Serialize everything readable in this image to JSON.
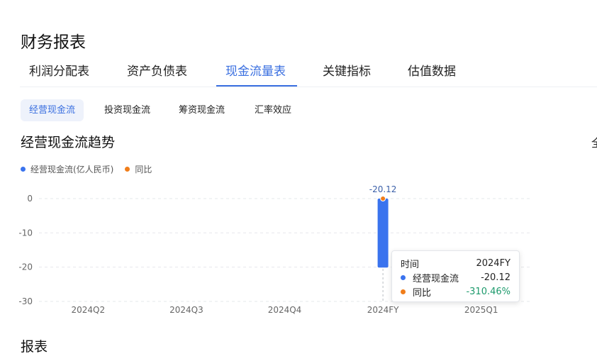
{
  "page": {
    "title": "财务报表"
  },
  "main_tabs": [
    {
      "label": "利润分配表"
    },
    {
      "label": "资产负债表"
    },
    {
      "label": "现金流量表",
      "active": true
    },
    {
      "label": "关键指标"
    },
    {
      "label": "估值数据"
    }
  ],
  "sub_tabs": [
    {
      "label": "经营现金流",
      "active": true
    },
    {
      "label": "投资现金流"
    },
    {
      "label": "筹资现金流"
    },
    {
      "label": "汇率效应"
    }
  ],
  "section": {
    "title": "经营现金流趋势",
    "edge_text": "全"
  },
  "footer": {
    "title": "报表"
  },
  "colors": {
    "series_bar": "#3a73ee",
    "series_yoy": "#f07d1a",
    "accent": "#3a6fe0",
    "positive_green": "#1d9a6c"
  },
  "chart_data": {
    "type": "bar",
    "categories": [
      "2024Q2",
      "2024Q3",
      "2024Q4",
      "2024FY",
      "2025Q1"
    ],
    "series": [
      {
        "name": "经营现金流(亿人民币)",
        "type": "bar",
        "values": [
          null,
          null,
          null,
          -20.12,
          null
        ]
      },
      {
        "name": "同比",
        "type": "line",
        "values": [
          null,
          null,
          null,
          -310.46,
          null
        ]
      }
    ],
    "ylim": [
      -30,
      0
    ],
    "yticks": [
      0,
      -10,
      -20,
      -30
    ],
    "data_label": {
      "category": "2024FY",
      "text": "-20.12"
    },
    "legend_position": "top-left",
    "grid": true,
    "xlabel": "",
    "ylabel": ""
  },
  "tooltip": {
    "header_label": "时间",
    "header_value": "2024FY",
    "rows": [
      {
        "label": "经营现金流",
        "value": "-20.12"
      },
      {
        "label": "同比",
        "value": "-310.46%"
      }
    ]
  }
}
